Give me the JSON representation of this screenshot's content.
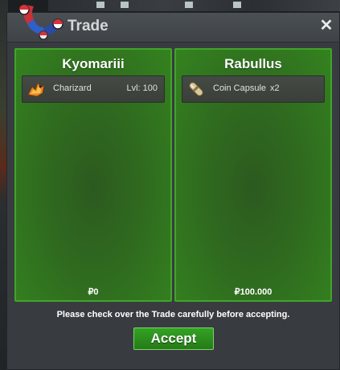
{
  "window": {
    "title": "Trade",
    "close_glyph": "✕"
  },
  "left_panel": {
    "name": "Kyomariii",
    "items": [
      {
        "name": "Charizard",
        "level": "Lvl: 100",
        "icon": "charizard-icon"
      }
    ],
    "money": "₽0"
  },
  "right_panel": {
    "name": "Rabullus",
    "items": [
      {
        "name": "Coin Capsule",
        "quantity": "x2",
        "icon": "coin-capsule-icon"
      }
    ],
    "money": "₽100.000"
  },
  "notice": "Please check over the Trade carefully before accepting.",
  "accept_label": "Accept",
  "colors": {
    "panel_green": "#2f6a1f",
    "panel_border": "#41a42a",
    "accept_green": "#2e9120",
    "window_bg": "#383c40"
  }
}
